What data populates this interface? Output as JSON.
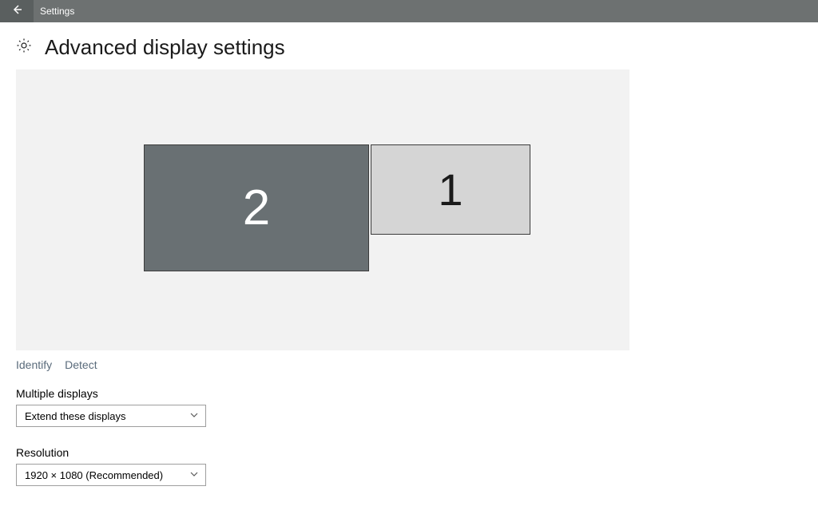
{
  "titlebar": {
    "app_name": "Settings"
  },
  "page": {
    "title": "Advanced display settings"
  },
  "monitors": {
    "primary_label": "2",
    "secondary_label": "1"
  },
  "links": {
    "identify": "Identify",
    "detect": "Detect"
  },
  "multiple_displays": {
    "label": "Multiple displays",
    "selected": "Extend these displays"
  },
  "resolution": {
    "label": "Resolution",
    "selected": "1920 × 1080 (Recommended)"
  }
}
